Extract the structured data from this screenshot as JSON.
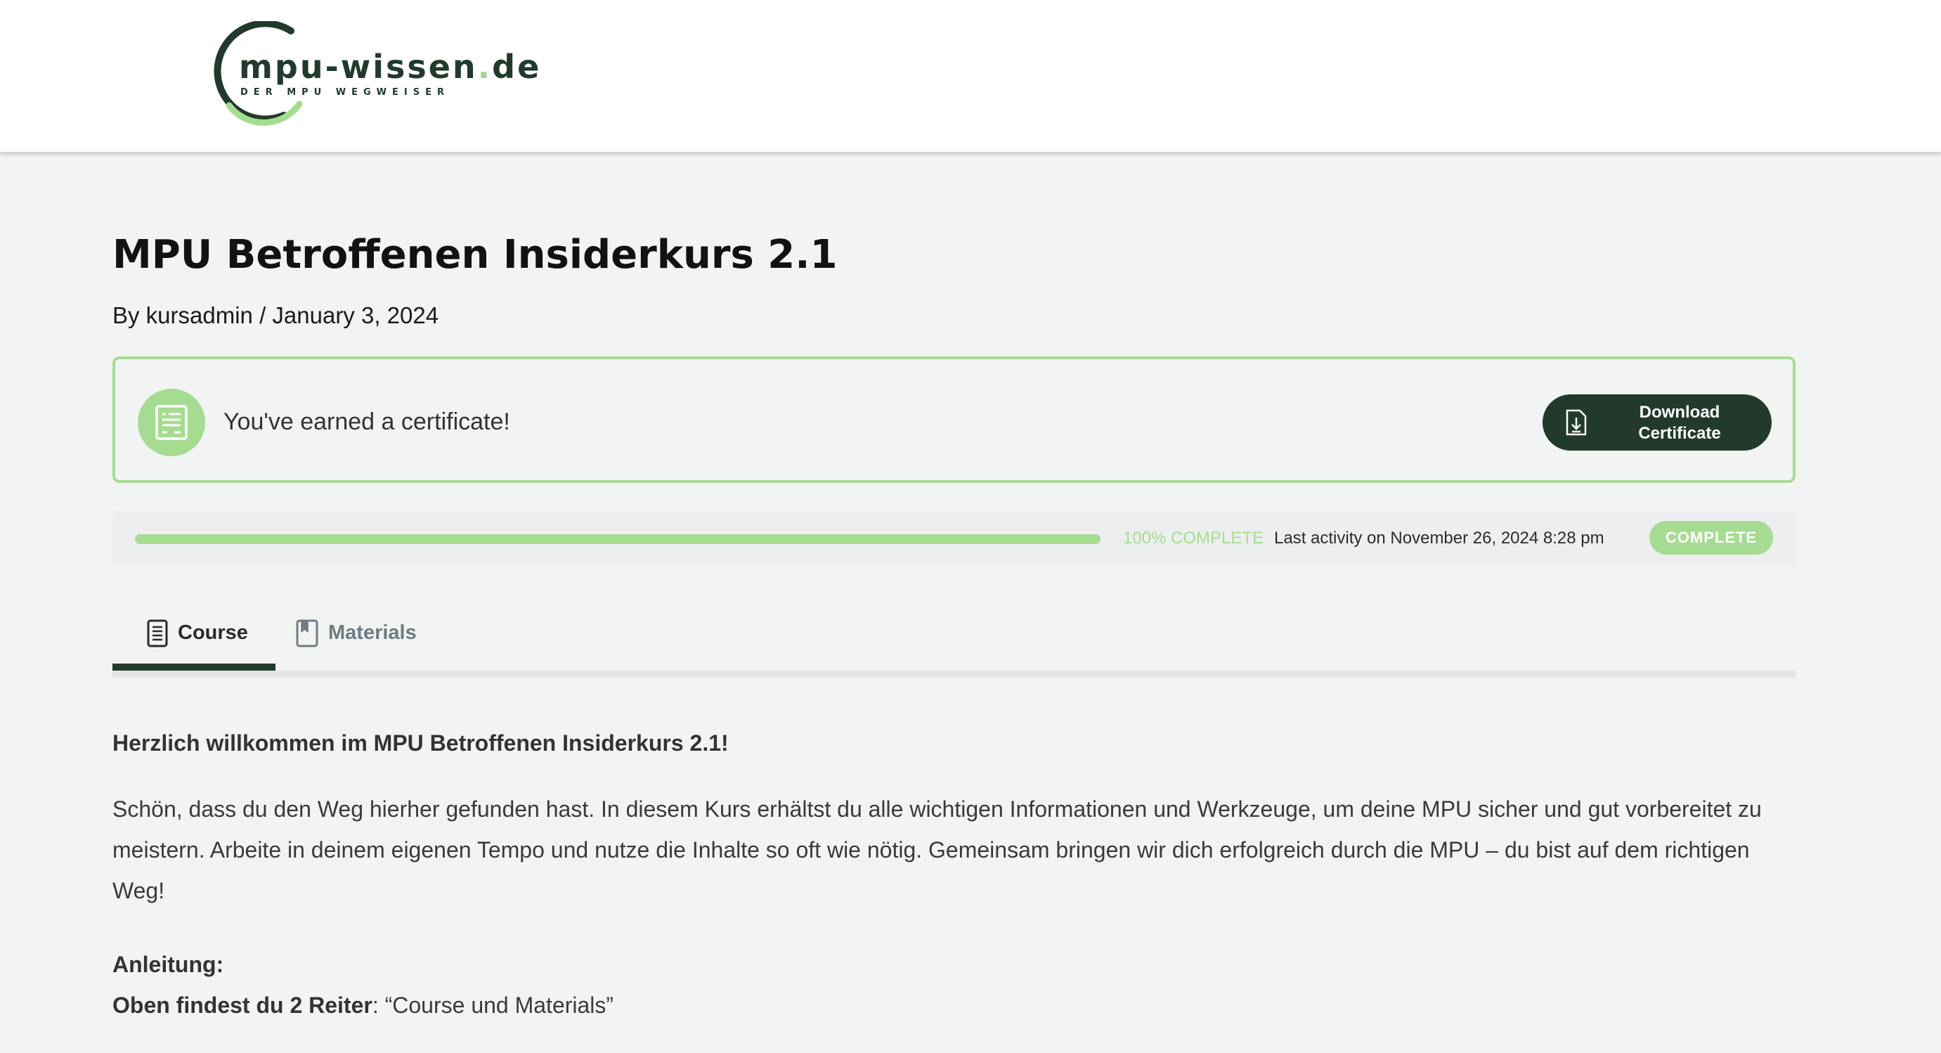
{
  "header": {
    "logo_name": "mpu-wissen",
    "logo_dot": ".",
    "logo_tld": "de",
    "logo_tagline": "DER MPU WEGWEISER",
    "brand_dark": "#223a2b",
    "brand_light": "#a6dc91"
  },
  "course": {
    "title": "MPU Betroffenen Insiderkurs 2.1",
    "meta": "By kursadmin / January 3, 2024"
  },
  "certificate": {
    "icon": "certificate-icon",
    "message": "You've earned a certificate!",
    "button_icon": "download-file-icon",
    "button_label": "Download Certificate"
  },
  "progress": {
    "percent": 100,
    "percent_label": "100% COMPLETE",
    "last_activity": "Last activity on November 26, 2024 8:28 pm",
    "status": "COMPLETE"
  },
  "tabs": [
    {
      "label": "Course",
      "icon": "document-icon",
      "active": true
    },
    {
      "label": "Materials",
      "icon": "bookmark-icon",
      "active": false
    }
  ],
  "content": {
    "welcome": "Herzlich willkommen im MPU Betroffenen Insiderkurs 2.1!",
    "intro": "Schön, dass du den Weg hierher gefunden hast. In diesem Kurs erhältst du alle wichtigen Informationen und Werkzeuge, um deine MPU sicher und gut vorbereitet zu meistern. Arbeite in deinem eigenen Tempo und nutze die Inhalte so oft wie nötig. Gemeinsam bringen wir dich erfolgreich durch die MPU – du bist auf dem richtigen Weg!",
    "anleitung": "Anleitung:",
    "reiter_bold": "Oben findest du 2 Reiter",
    "reiter_rest": ": “Course und Materials”"
  }
}
